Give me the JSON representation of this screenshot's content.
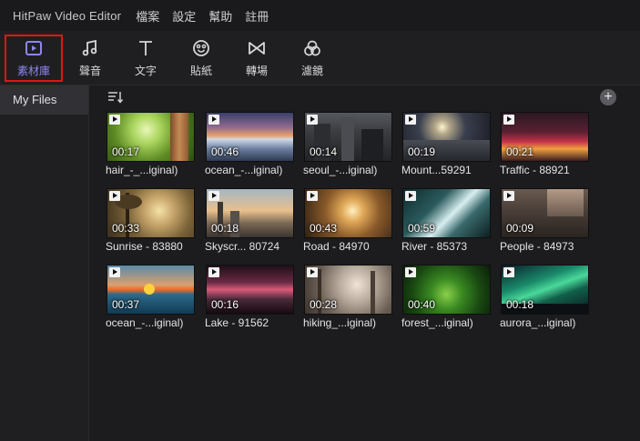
{
  "app": {
    "title": "HitPaw Video Editor"
  },
  "menu": [
    "檔案",
    "設定",
    "幫助",
    "註冊"
  ],
  "toolbar": {
    "items": [
      {
        "label": "素材庫",
        "icon": "media-icon",
        "active": true
      },
      {
        "label": "聲音",
        "icon": "music-note-icon"
      },
      {
        "label": "文字",
        "icon": "text-icon"
      },
      {
        "label": "貼紙",
        "icon": "sticker-icon"
      },
      {
        "label": "轉場",
        "icon": "transition-icon"
      },
      {
        "label": "濾鏡",
        "icon": "filter-icon"
      }
    ]
  },
  "sidebar": {
    "items": [
      {
        "label": "My Files",
        "selected": true
      }
    ]
  },
  "clips": [
    {
      "name": "hair_-_...iginal)",
      "duration": "00:17"
    },
    {
      "name": "ocean_-...iginal)",
      "duration": "00:46"
    },
    {
      "name": "seoul_-...iginal)",
      "duration": "00:14"
    },
    {
      "name": "Mount...59291",
      "duration": "00:19"
    },
    {
      "name": "Traffic - 88921",
      "duration": "00:21"
    },
    {
      "name": "Sunrise - 83880",
      "duration": "00:33"
    },
    {
      "name": "Skyscr... 80724",
      "duration": "00:18"
    },
    {
      "name": "Road - 84970",
      "duration": "00:43"
    },
    {
      "name": "River - 85373",
      "duration": "00:59"
    },
    {
      "name": "People - 84973",
      "duration": "00:09"
    },
    {
      "name": "ocean_-...iginal)",
      "duration": "00:37"
    },
    {
      "name": "Lake - 91562",
      "duration": "00:16"
    },
    {
      "name": "hiking_...iginal)",
      "duration": "00:28"
    },
    {
      "name": "forest_...iginal)",
      "duration": "00:40"
    },
    {
      "name": "aurora_...iginal)",
      "duration": "00:18"
    }
  ],
  "colors": {
    "accent": "#8d86f5",
    "highlight_border": "#e01515"
  }
}
